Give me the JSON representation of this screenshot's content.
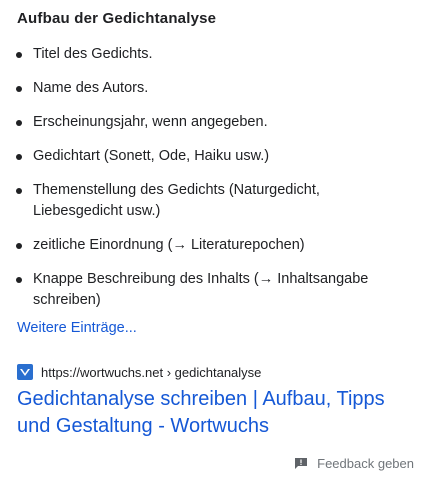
{
  "snippet": {
    "title": "Aufbau der Gedichtanalyse",
    "items": [
      "Titel des Gedichts.",
      "Name des Autors.",
      "Erscheinungsjahr, wenn angegeben.",
      "Gedichtart (Sonett, Ode, Haiku usw.)",
      "Themenstellung des Gedichts (Naturgedicht, Liebesgedicht usw.)",
      "zeitliche Einordnung (→ Literaturepochen)",
      "Knappe Beschreibung des Inhalts (→ Inhaltsangabe schreiben)"
    ],
    "more_link": "Weitere Einträge..."
  },
  "result": {
    "favicon": "wortwuchs-diamond-icon",
    "url": "https://wortwuchs.net › gedichtanalyse",
    "title": "Gedichtanalyse schreiben | Aufbau, Tipps und Gestaltung - Wortwuchs"
  },
  "feedback": {
    "icon": "feedback-icon",
    "label": "Feedback geben"
  },
  "colors": {
    "link": "#1558d6",
    "text": "#202124",
    "muted": "#70757a",
    "favicon_bg": "#2a6fcf"
  }
}
